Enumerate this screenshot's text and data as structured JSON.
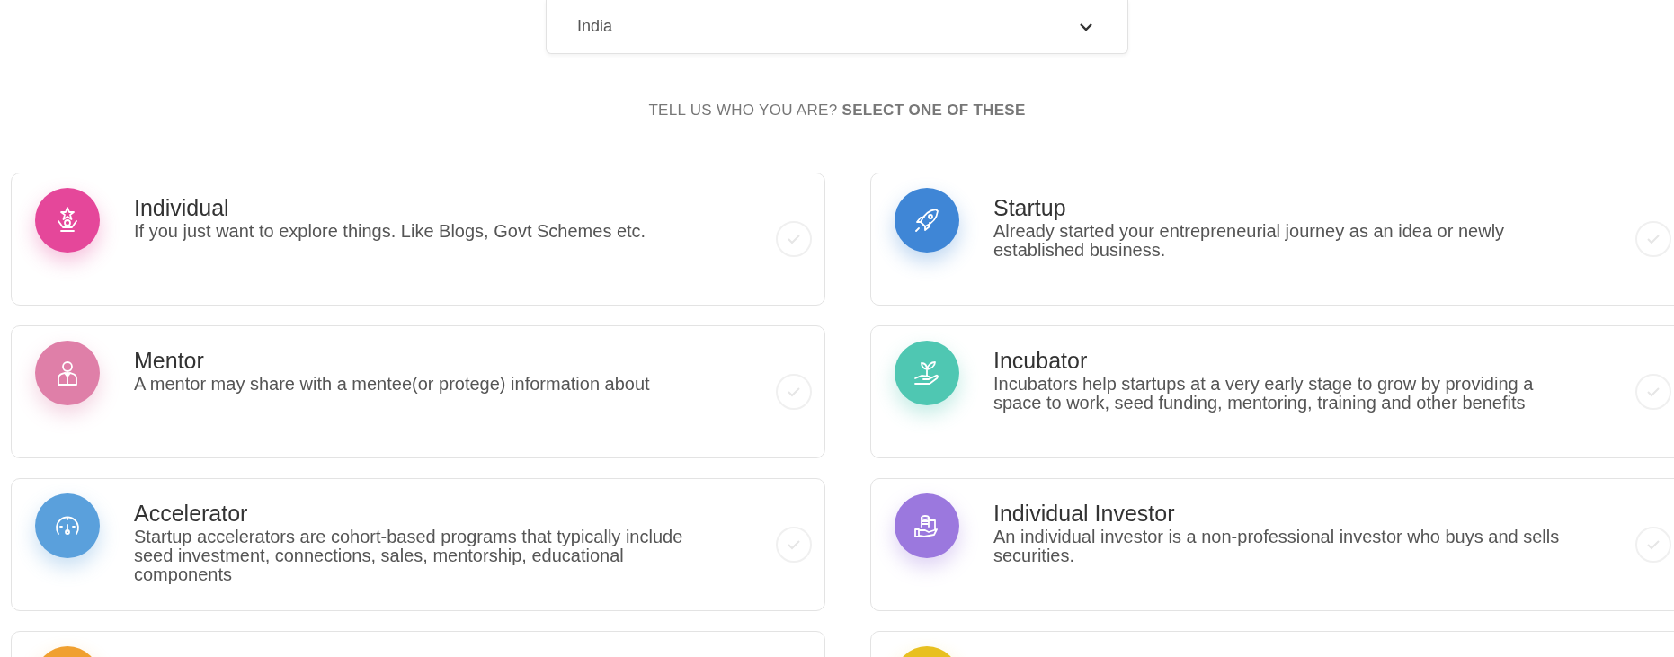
{
  "country_select": {
    "value": "India"
  },
  "prompt": {
    "text": "TELL US WHO YOU ARE? **SELECT ONE OF THESE**"
  },
  "roles": [
    {
      "kind": "star",
      "title": "Individual",
      "description": "If you just want to explore things. Like Blogs, Govt Schemes etc.",
      "color": "#e5479a",
      "selected": false
    },
    {
      "kind": "rocket",
      "title": "Startup",
      "description": "Already started your entrepreneurial journey as an idea or newly established business.",
      "color": "#3f86d6",
      "selected": false
    },
    {
      "kind": "person",
      "title": "Mentor",
      "description": "A mentor may share with a mentee(or protege) information about",
      "color": "#df7fa8",
      "selected": false
    },
    {
      "kind": "plant",
      "title": "Incubator",
      "description": "Incubators help startups at a very early stage to grow by providing a space to work, seed funding, mentoring, training and other benefits",
      "color": "#4fc7b2",
      "selected": false
    },
    {
      "kind": "gauge",
      "title": "Accelerator",
      "description": "Startup accelerators are cohort-based programs that typically include seed investment, connections, sales, mentorship, educational components",
      "color": "#5aa0dc",
      "selected": false
    },
    {
      "kind": "coins",
      "title": "Individual Investor",
      "description": "An individual investor is a non-professional investor who buys and sells securities.",
      "color": "#9b78de",
      "selected": false
    },
    {
      "kind": "cut",
      "color": "#f0a030"
    },
    {
      "kind": "cut",
      "color": "#e8c020"
    }
  ]
}
